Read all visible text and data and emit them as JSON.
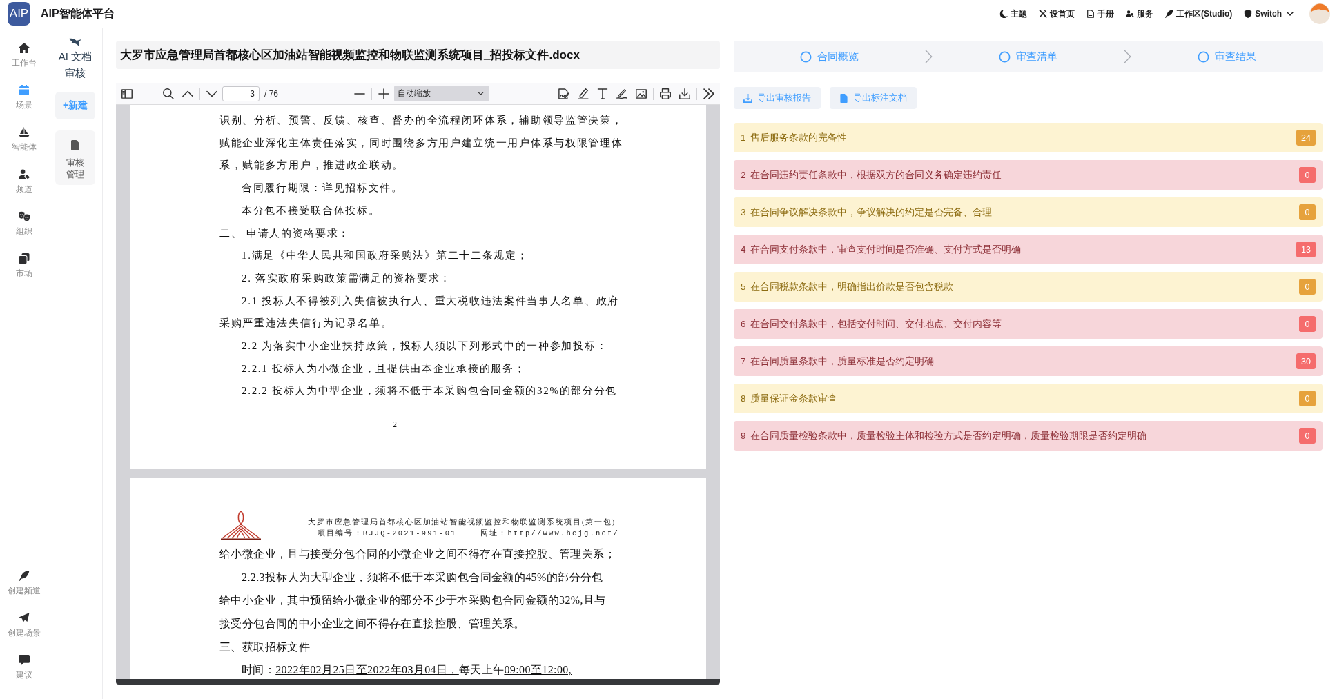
{
  "header": {
    "logo": "AIP",
    "title": "AIP智能体平台",
    "links": [
      {
        "label": "主题",
        "dropdown": false
      },
      {
        "label": "设首页",
        "dropdown": false
      },
      {
        "label": "手册",
        "dropdown": false
      },
      {
        "label": "服务",
        "dropdown": false
      },
      {
        "label": "工作区(Studio)",
        "dropdown": false
      },
      {
        "label": "Switch",
        "dropdown": true
      }
    ]
  },
  "nav": {
    "items": [
      {
        "label": "工作台",
        "selected": false
      },
      {
        "label": "场景",
        "selected": true
      },
      {
        "label": "智能体",
        "selected": false
      },
      {
        "label": "频道",
        "selected": false
      },
      {
        "label": "组织",
        "selected": false
      },
      {
        "label": "市场",
        "selected": false
      }
    ],
    "bottom_items": [
      {
        "label": "创建频道"
      },
      {
        "label": "创建场景"
      },
      {
        "label": "建议"
      }
    ]
  },
  "app_sidebar": {
    "title": "AI 文档审核",
    "new_button": "+新建",
    "items": [
      {
        "label": "审核管理"
      }
    ]
  },
  "document": {
    "title": "大罗市应急管理局首都核心区加油站智能视频监控和物联监测系统项目_招投标文件.docx",
    "toolbar": {
      "page": "3",
      "page_count": "/ 76",
      "zoom": "自动缩放"
    },
    "pages": [
      {
        "lines": [
          {
            "kind": "flush",
            "text": "识别、分析、预警、反馈、核查、督办的全流程闭环体系，辅助领导监管决策，"
          },
          {
            "kind": "flush",
            "text": "赋能企业深化主体责任落实，同时围绕多方用户建立统一用户体系与权限管理体"
          },
          {
            "kind": "flush",
            "text": "系，赋能多方用户，推进政企联动。"
          },
          {
            "kind": "indent",
            "text": "合同履行期限：详见招标文件。"
          },
          {
            "kind": "indent",
            "text": "本分包不接受联合体投标。"
          },
          {
            "kind": "flush",
            "text": "二、 申请人的资格要求："
          },
          {
            "kind": "indent",
            "text": "1.满足《中华人民共和国政府采购法》第二十二条规定；"
          },
          {
            "kind": "indent",
            "text": "2. 落实政府采购政策需满足的资格要求："
          },
          {
            "kind": "indent",
            "text": "2.1 投标人不得被列入失信被执行人、重大税收违法案件当事人名单、政府"
          },
          {
            "kind": "flush",
            "text": "采购严重违法失信行为记录名单。"
          },
          {
            "kind": "indent",
            "text": "2.2 为落实中小企业扶持政策，投标人须以下列形式中的一种参加投标："
          },
          {
            "kind": "indent",
            "text": "2.2.1 投标人为小微企业，且提供由本企业承接的服务；"
          },
          {
            "kind": "indent",
            "text": "2.2.2 投标人为中型企业，须将不低于本采购包合同金额的32%的部分分包"
          }
        ],
        "page_number": "2"
      },
      {
        "letterhead": {
          "title": "大罗市应急管理局首都核心区加油站智能视频监控和物联监测系统项目(第一包)",
          "project_no": "项目编号：BJJQ-2021-991-01",
          "website": "网址：http//www.hcjg.net/"
        },
        "lines": [
          {
            "kind": "flush",
            "text": "给小微企业，且与接受分包合同的小微企业之间不得存在直接控股、管理关系；"
          },
          {
            "kind": "indent",
            "text": "2.2.3投标人为大型企业，须将不低于本采购包合同金额的45%的部分分包"
          },
          {
            "kind": "flush",
            "text": "给中小企业，其中预留给小微企业的部分不少于本采购包合同金额的32%,且与"
          },
          {
            "kind": "flush",
            "text": "接受分包合同的中小企业之间不得存在直接控股、管理关系。"
          },
          {
            "kind": "flush",
            "text": "三、获取招标文件"
          },
          {
            "kind": "indent",
            "segments": [
              {
                "text": "时间：",
                "underlined": false
              },
              {
                "text": "2022年02月25日至2022年03月04日，",
                "underlined": true
              },
              {
                "text": "每天上午",
                "underlined": false
              },
              {
                "text": "09:00至12:00,",
                "underlined": true
              }
            ]
          }
        ]
      }
    ]
  },
  "review": {
    "steps": [
      {
        "label": "合同概览"
      },
      {
        "label": "审查清单"
      },
      {
        "label": "审查结果"
      }
    ],
    "exports": [
      {
        "label": "导出审核报告"
      },
      {
        "label": "导出标注文档"
      }
    ],
    "items": [
      {
        "number": "1",
        "text": "售后服务条款的完备性",
        "count": "24",
        "kind": "warning"
      },
      {
        "number": "2",
        "text": "在合同违约责任条款中，根据双方的合同义务确定违约责任",
        "count": "0",
        "kind": "danger"
      },
      {
        "number": "3",
        "text": "在合同争议解决条款中，争议解决的约定是否完备、合理",
        "count": "0",
        "kind": "warning"
      },
      {
        "number": "4",
        "text": "在合同支付条款中，审查支付时间是否准确、支付方式是否明确",
        "count": "13",
        "kind": "danger"
      },
      {
        "number": "5",
        "text": "在合同税款条款中，明确指出价款是否包含税款",
        "count": "0",
        "kind": "warning"
      },
      {
        "number": "6",
        "text": "在合同交付条款中，包括交付时间、交付地点、交付内容等",
        "count": "0",
        "kind": "danger"
      },
      {
        "number": "7",
        "text": "在合同质量条款中，质量标准是否约定明确",
        "count": "30",
        "kind": "danger"
      },
      {
        "number": "8",
        "text": "质量保证金条款审查",
        "count": "0",
        "kind": "warning"
      },
      {
        "number": "9",
        "text": "在合同质量检验条款中，质量检验主体和检验方式是否约定明确，质量检验期限是否约定明确",
        "count": "0",
        "kind": "danger"
      }
    ]
  }
}
